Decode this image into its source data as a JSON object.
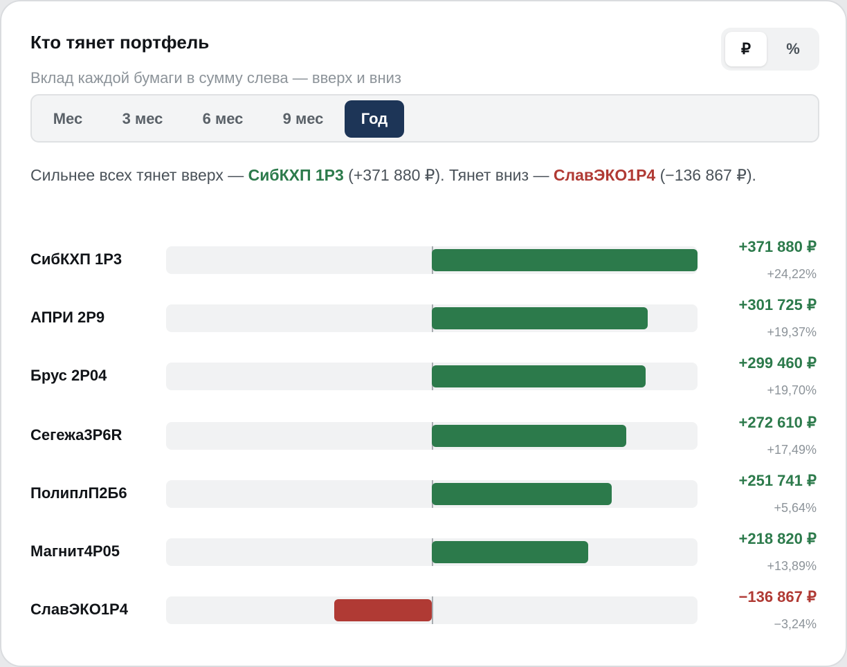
{
  "header": {
    "title": "Кто тянет портфель",
    "subtitle": "Вклад каждой бумаги в сумму слева — вверх и вниз"
  },
  "unit_toggle": {
    "options": [
      "₽",
      "%"
    ],
    "selected": "₽"
  },
  "periods": {
    "options": [
      "Мес",
      "3 мес",
      "6 мес",
      "9 мес",
      "Год"
    ],
    "selected": "Год"
  },
  "summary": {
    "prefix": "Сильнее всех тянет вверх — ",
    "top_name": "СибКХП 1Р3",
    "top_value": " (+371 880 ₽). Тянет вниз — ",
    "bottom_name": "СлавЭКО1Р4",
    "bottom_value": " (−136 867 ₽)."
  },
  "colors": {
    "positive": "#2c7a4b",
    "negative": "#b03a34",
    "active_period": "#1d3557"
  },
  "rows": [
    {
      "name": "СибКХП 1Р3",
      "amount_label": "+371 880 ₽",
      "pct_label": "+24,22%",
      "amount": 371880
    },
    {
      "name": "АПРИ 2Р9",
      "amount_label": "+301 725 ₽",
      "pct_label": "+19,37%",
      "amount": 301725
    },
    {
      "name": "Брус 2Р04",
      "amount_label": "+299 460 ₽",
      "pct_label": "+19,70%",
      "amount": 299460
    },
    {
      "name": "Сегежа3Р6R",
      "amount_label": "+272 610 ₽",
      "pct_label": "+17,49%",
      "amount": 272610
    },
    {
      "name": "ПолиплП2Б6",
      "amount_label": "+251 741 ₽",
      "pct_label": "+5,64%",
      "amount": 251741
    },
    {
      "name": "Магнит4Р05",
      "amount_label": "+218 820 ₽",
      "pct_label": "+13,89%",
      "amount": 218820
    },
    {
      "name": "СлавЭКО1Р4",
      "amount_label": "−136 867 ₽",
      "pct_label": "−3,24%",
      "amount": -136867
    }
  ]
}
